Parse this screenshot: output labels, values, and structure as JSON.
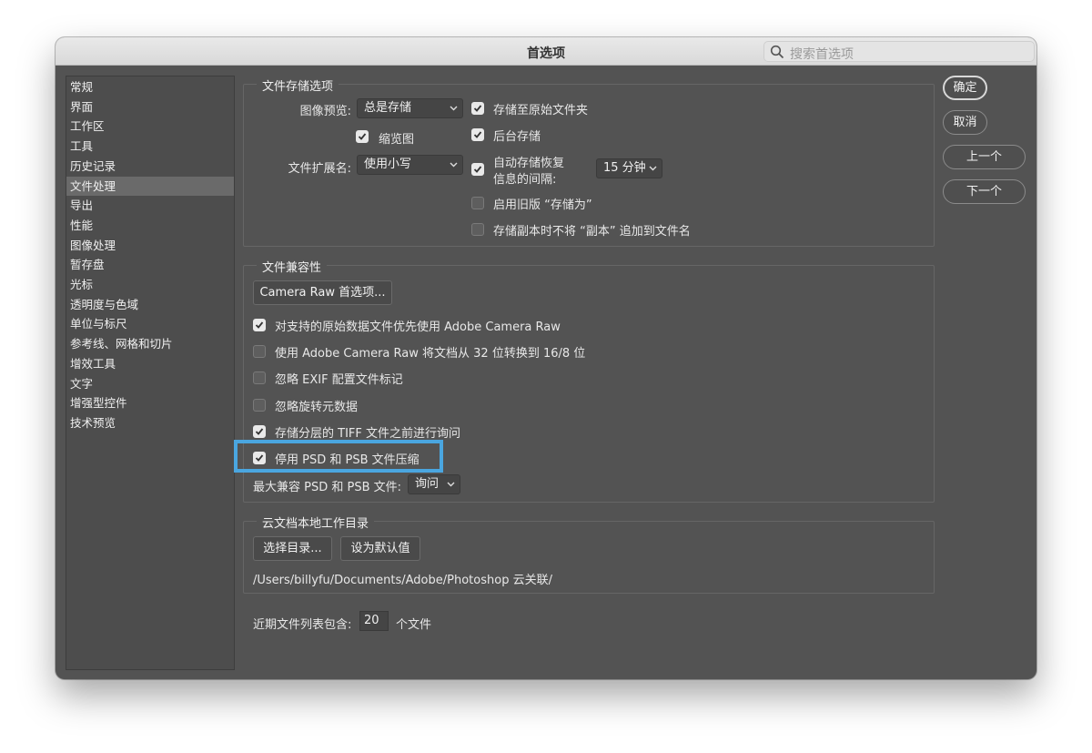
{
  "window": {
    "title": "首选项"
  },
  "search": {
    "placeholder": "搜索首选项"
  },
  "sidebar": {
    "selected_index": 5,
    "items": [
      {
        "label": "常规"
      },
      {
        "label": "界面"
      },
      {
        "label": "工作区"
      },
      {
        "label": "工具"
      },
      {
        "label": "历史记录"
      },
      {
        "label": "文件处理"
      },
      {
        "label": "导出"
      },
      {
        "label": "性能"
      },
      {
        "label": "图像处理"
      },
      {
        "label": "暂存盘"
      },
      {
        "label": "光标"
      },
      {
        "label": "透明度与色域"
      },
      {
        "label": "单位与标尺"
      },
      {
        "label": "参考线、网格和切片"
      },
      {
        "label": "增效工具"
      },
      {
        "label": "文字"
      },
      {
        "label": "增强型控件"
      },
      {
        "label": "技术预览"
      }
    ]
  },
  "file_save": {
    "title": "文件存储选项",
    "image_preview_label": "图像预览:",
    "image_preview_value": "总是存储",
    "thumbnail_label": "缩览图",
    "thumbnail_checked": true,
    "extension_label": "文件扩展名:",
    "extension_value": "使用小写",
    "save_to_original": {
      "label": "存储至原始文件夹",
      "checked": true
    },
    "background_save": {
      "label": "后台存储",
      "checked": true
    },
    "auto_save": {
      "label_line1": "自动存储恢复",
      "label_line2": "信息的间隔:",
      "checked": true,
      "interval": "15 分钟"
    },
    "legacy_save_as": {
      "label": "启用旧版 “存储为”",
      "checked": false
    },
    "no_copy_suffix": {
      "label": "存储副本时不将 “副本” 追加到文件名",
      "checked": false
    }
  },
  "compat": {
    "title": "文件兼容性",
    "camera_raw_button": "Camera Raw 首选项...",
    "options": [
      {
        "label": "对支持的原始数据文件优先使用 Adobe Camera Raw",
        "checked": true
      },
      {
        "label": "使用 Adobe Camera Raw 将文档从 32 位转换到 16/8 位",
        "checked": false
      },
      {
        "label": "忽略 EXIF 配置文件标记",
        "checked": false
      },
      {
        "label": "忽略旋转元数据",
        "checked": false
      },
      {
        "label": "存储分层的 TIFF 文件之前进行询问",
        "checked": true
      },
      {
        "label": "停用 PSD 和 PSB 文件压缩",
        "checked": true
      }
    ],
    "max_compat_label": "最大兼容 PSD 和 PSB 文件:",
    "max_compat_value": "询问"
  },
  "cloud": {
    "title": "云文档本地工作目录",
    "choose_button": "选择目录...",
    "default_button": "设为默认值",
    "path": "/Users/billyfu/Documents/Adobe/Photoshop 云关联/"
  },
  "recent": {
    "label": "近期文件列表包含:",
    "value": "20",
    "suffix": "个文件"
  },
  "actions": {
    "ok": "确定",
    "cancel": "取消",
    "prev": "上一个",
    "next": "下一个"
  },
  "colors": {
    "window_bg": "#535353",
    "highlight": "#4aa6e0"
  }
}
